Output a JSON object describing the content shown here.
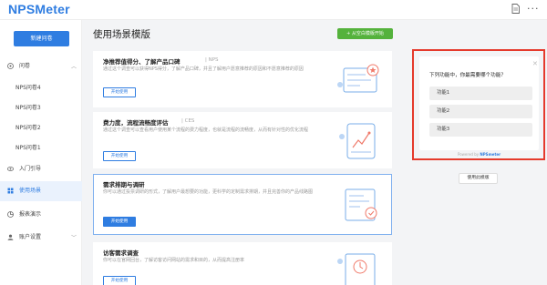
{
  "header": {
    "logo": "NPSMeter",
    "more_label": "···"
  },
  "sidebar": {
    "new_button": "新建问卷",
    "items": [
      {
        "label": "问卷"
      },
      {
        "label": "NPS问卷4"
      },
      {
        "label": "NPS问卷3"
      },
      {
        "label": "NPS问卷2"
      },
      {
        "label": "NPS问卷1"
      },
      {
        "label": "入门引导"
      },
      {
        "label": "使用场景"
      },
      {
        "label": "报表演示"
      },
      {
        "label": "账户设置"
      }
    ]
  },
  "main": {
    "title": "使用场景模版",
    "start_button": "+ 从空白模版开始",
    "cards": [
      {
        "title": "净推荐值得分、了解产品口碑",
        "tag": "NPS",
        "desc": "通过这个调查可以获得NPS得分，了解产品口碑，并且了解用户愿意推荐的原因和不愿意推荐的原因",
        "button": "开始使用"
      },
      {
        "title": "费力度，流程流畅度评估",
        "tag": "CES",
        "desc": "通过这个调查可以查看用户使用某个流程的费力程度，也就是流程的流畅度，从而有针对性的优化流程",
        "button": "开始使用"
      },
      {
        "title": "需求排期与调研",
        "tag": "",
        "desc": "你可以通过投票调研的形式，了解用户最想要的功能，更科学的定制需求排期，并且完善你的产品线路图",
        "button": "开始使用"
      },
      {
        "title": "访客需求调查",
        "tag": "",
        "desc": "你可以在官网回台，了解访客访问网站的需求和目的，从而提高注册率",
        "button": "开始使用"
      }
    ]
  },
  "preview": {
    "close": "✕",
    "question": "下列功能中，你最需要哪个功能？",
    "options": [
      "功能1",
      "功能2",
      "功能3"
    ],
    "powered_prefix": "Powered by",
    "powered_brand": "NPSmeter",
    "use_template_button": "使用此模版"
  },
  "colors": {
    "brand_blue": "#2f7de1",
    "start_green": "#54b23c",
    "highlight_red": "#e53a2c"
  }
}
